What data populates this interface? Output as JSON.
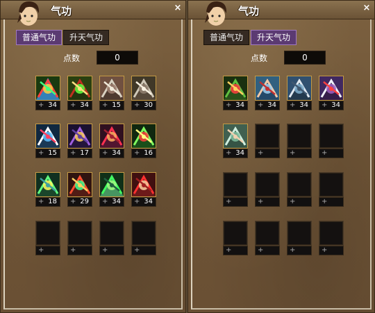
{
  "colors": {
    "panel_bg": "#6e5436",
    "active_tab": "#5b3a72",
    "slot_border": "#c49a44"
  },
  "panels": [
    {
      "title": "气功",
      "tabs": [
        {
          "label": "普通气功",
          "active": true
        },
        {
          "label": "升天气功",
          "active": false
        }
      ],
      "points_label": "点数",
      "points_value": "0",
      "close": "×",
      "slots": [
        {
          "level": "34",
          "icon": "rainbow-burst-icon"
        },
        {
          "level": "34",
          "icon": "green-orb-icon"
        },
        {
          "level": "15",
          "icon": "sword-icon"
        },
        {
          "level": "30",
          "icon": "smoke-swirl-icon"
        },
        {
          "level": "15",
          "icon": "blade-slash-icon"
        },
        {
          "level": "17",
          "icon": "purple-spiral-icon"
        },
        {
          "level": "34",
          "icon": "red-flame-icon"
        },
        {
          "level": "16",
          "icon": "green-flare-icon"
        },
        {
          "level": "18",
          "icon": "green-starburst-icon"
        },
        {
          "level": "29",
          "icon": "red-vortex-icon"
        },
        {
          "level": "34",
          "icon": "green-rays-icon"
        },
        {
          "level": "34",
          "icon": "red-dragon-icon"
        },
        {
          "level": "",
          "icon": ""
        },
        {
          "level": "",
          "icon": ""
        },
        {
          "level": "",
          "icon": ""
        },
        {
          "level": "",
          "icon": ""
        }
      ]
    },
    {
      "title": "气功",
      "tabs": [
        {
          "label": "普通气功",
          "active": false
        },
        {
          "label": "升天气功",
          "active": true
        }
      ],
      "points_label": "点数",
      "points_value": "0",
      "close": "×",
      "slots": [
        {
          "level": "34",
          "icon": "bamboo-strike-icon"
        },
        {
          "level": "34",
          "icon": "fist-sky-icon"
        },
        {
          "level": "34",
          "icon": "blade-sky-icon"
        },
        {
          "level": "34",
          "icon": "masked-figure-icon"
        },
        {
          "level": "34",
          "icon": "heal-sky-icon"
        },
        {
          "level": "",
          "icon": ""
        },
        {
          "level": "",
          "icon": ""
        },
        {
          "level": "",
          "icon": ""
        },
        {
          "level": "",
          "icon": ""
        },
        {
          "level": "",
          "icon": ""
        },
        {
          "level": "",
          "icon": ""
        },
        {
          "level": "",
          "icon": ""
        },
        {
          "level": "",
          "icon": ""
        },
        {
          "level": "",
          "icon": ""
        },
        {
          "level": "",
          "icon": ""
        },
        {
          "level": "",
          "icon": ""
        }
      ]
    }
  ]
}
